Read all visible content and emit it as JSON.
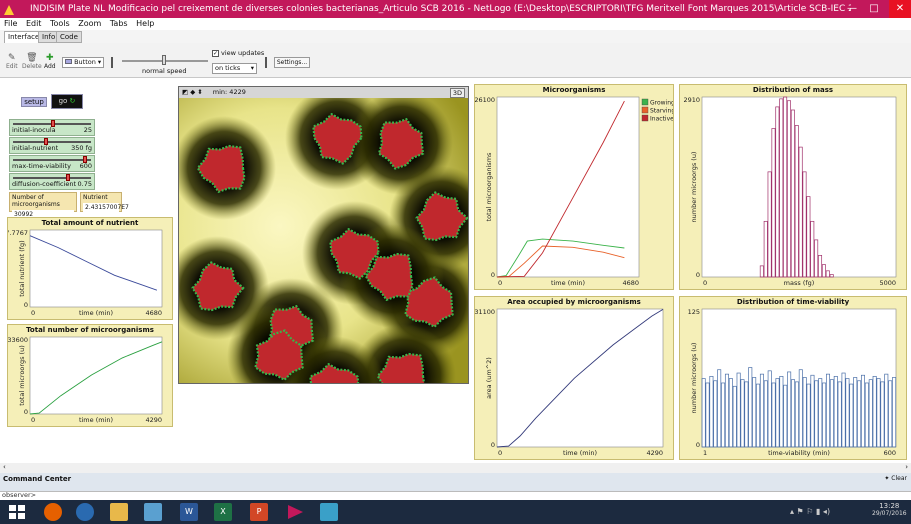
{
  "window": {
    "title": "INDISIM Plate NL Modificacio pel creixement de diverses colonies bacterianas_Articulo SCB 2016 - NetLogo (E:\\Desktop\\ESCRIPTORI\\TFG Meritxell Font Marques 2015\\Article SCB-IEC 2016)"
  },
  "menu": [
    "File",
    "Edit",
    "Tools",
    "Zoom",
    "Tabs",
    "Help"
  ],
  "tabs": [
    "Interface",
    "Info",
    "Code"
  ],
  "toolbar": {
    "edit": "Edit",
    "delete": "Delete",
    "add": "Add",
    "widget_type": "Button",
    "speed_label": "normal speed",
    "view_updates": "view updates",
    "update_mode": "on ticks",
    "settings": "Settings..."
  },
  "buttons": {
    "setup": "setup",
    "go": "go"
  },
  "sliders": [
    {
      "label": "initial-inocula",
      "value": "25",
      "level": 0.52
    },
    {
      "label": "initial-nutrient",
      "value": "350 fg",
      "level": 0.42
    },
    {
      "label": "max-time-viability",
      "value": "600",
      "level": 0.95
    },
    {
      "label": "diffusion-coefficient",
      "value": "0.75",
      "level": 0.72
    }
  ],
  "monitors": [
    {
      "label": "Number of microorganisms",
      "value": "30992"
    },
    {
      "label": "Nutrient",
      "value": "2.43157007E7"
    }
  ],
  "view": {
    "ticks_label": "min: 4229",
    "zoom": "3D"
  },
  "colors": {
    "growing": "#3bb34a",
    "starving": "#e8622a",
    "inactive": "#c0282d",
    "nutrient_line": "#3b4a9a",
    "count_line": "#2aa040",
    "area_line": "#333a7a",
    "mass_bars": "#a0306a",
    "viability_bars": "#4a6fa8"
  },
  "chart_data": [
    {
      "type": "line",
      "title": "Total amount of nutrient",
      "xlabel": "time (min)",
      "ylabel": "total nutrient (fg)",
      "xlim": [
        0,
        4680
      ],
      "ylim": [
        0,
        7.7767
      ],
      "ymin_label": "0",
      "ymax_label": "7.7767",
      "xmin_label": "0",
      "xmax_label": "4680",
      "series": [
        {
          "x": [
            0,
            1000,
            2000,
            3000,
            4000,
            4500
          ],
          "y": [
            7.2,
            6.0,
            4.6,
            3.2,
            2.2,
            1.7
          ]
        }
      ]
    },
    {
      "type": "line",
      "title": "Total number of microorganisms",
      "xlabel": "time (min)",
      "ylabel": "total microorgs (u)",
      "xlim": [
        0,
        4290
      ],
      "ylim": [
        0,
        33600
      ],
      "ymin_label": "0",
      "ymax_label": "33600",
      "xmin_label": "0",
      "xmax_label": "4290",
      "series": [
        {
          "x": [
            0,
            300,
            1000,
            2000,
            3000,
            4000,
            4290
          ],
          "y": [
            0,
            400,
            8000,
            17000,
            24500,
            30000,
            31500
          ]
        }
      ]
    },
    {
      "type": "line",
      "title": "Microorganisms",
      "xlabel": "time (min)",
      "ylabel": "total microorganisms",
      "xlim": [
        0,
        4680
      ],
      "ylim": [
        0,
        26100
      ],
      "ymin_label": "0",
      "ymax_label": "26100",
      "xmin_label": "0",
      "xmax_label": "4680",
      "series": [
        {
          "name": "Growing",
          "x": [
            0,
            300,
            700,
            1000,
            1500,
            2500,
            3500,
            4200
          ],
          "y": [
            0,
            200,
            3000,
            5200,
            5500,
            5200,
            4600,
            4200
          ]
        },
        {
          "name": "Starving",
          "x": [
            0,
            400,
            900,
            1500,
            2500,
            3500,
            4200
          ],
          "y": [
            0,
            100,
            2000,
            4500,
            4300,
            3600,
            2800
          ]
        },
        {
          "name": "Inactive",
          "x": [
            0,
            900,
            1500,
            2500,
            3500,
            4200
          ],
          "y": [
            0,
            100,
            3500,
            11500,
            19500,
            25500
          ]
        }
      ]
    },
    {
      "type": "bar",
      "title": "Distribution of mass",
      "xlabel": "mass (fg)",
      "ylabel": "number microorgs (u)",
      "xlim": [
        0,
        5000
      ],
      "ylim": [
        0,
        2910
      ],
      "ymin_label": "0",
      "ymax_label": "2910",
      "xmin_label": "0",
      "xmax_label": "5000",
      "bins": {
        "x_start": 1500,
        "width": 100,
        "values": [
          180,
          900,
          1700,
          2400,
          2750,
          2880,
          2910,
          2850,
          2700,
          2450,
          2100,
          1700,
          1300,
          900,
          600,
          350,
          200,
          100,
          40
        ]
      }
    },
    {
      "type": "line",
      "title": "Area occupied by microorganisms",
      "xlabel": "time (min)",
      "ylabel": "area (um^2)",
      "xlim": [
        0,
        4290
      ],
      "ylim": [
        0,
        31100
      ],
      "ymin_label": "0",
      "ymax_label": "31100",
      "xmin_label": "0",
      "xmax_label": "4290",
      "series": [
        {
          "x": [
            0,
            300,
            600,
            1000,
            2000,
            3000,
            4000,
            4290
          ],
          "y": [
            0,
            200,
            2500,
            6500,
            15500,
            23000,
            29500,
            31000
          ]
        }
      ]
    },
    {
      "type": "bar",
      "title": "Distribution of time-viability",
      "xlabel": "time-viability (min)",
      "ylabel": "number microorgs (u)",
      "xlim": [
        1,
        600
      ],
      "ylim": [
        0,
        125
      ],
      "ymin_label": "0",
      "ymax_label": "125",
      "xmin_label": "1",
      "xmax_label": "600",
      "bins": {
        "x_start": 1,
        "width": 12,
        "values": [
          62,
          58,
          64,
          60,
          70,
          58,
          66,
          62,
          55,
          67,
          61,
          59,
          72,
          63,
          57,
          66,
          60,
          69,
          58,
          62,
          64,
          56,
          68,
          61,
          59,
          70,
          63,
          57,
          65,
          60,
          62,
          58,
          66,
          61,
          64,
          59,
          67,
          62,
          57,
          63,
          60,
          65,
          58,
          61,
          64,
          62,
          59,
          66,
          60,
          63
        ]
      }
    }
  ],
  "cmd": {
    "title": "Command Center",
    "clear": "Clear",
    "prompt": "observer>"
  },
  "taskbar": {
    "time": "13:28",
    "date": "29/07/2016"
  }
}
